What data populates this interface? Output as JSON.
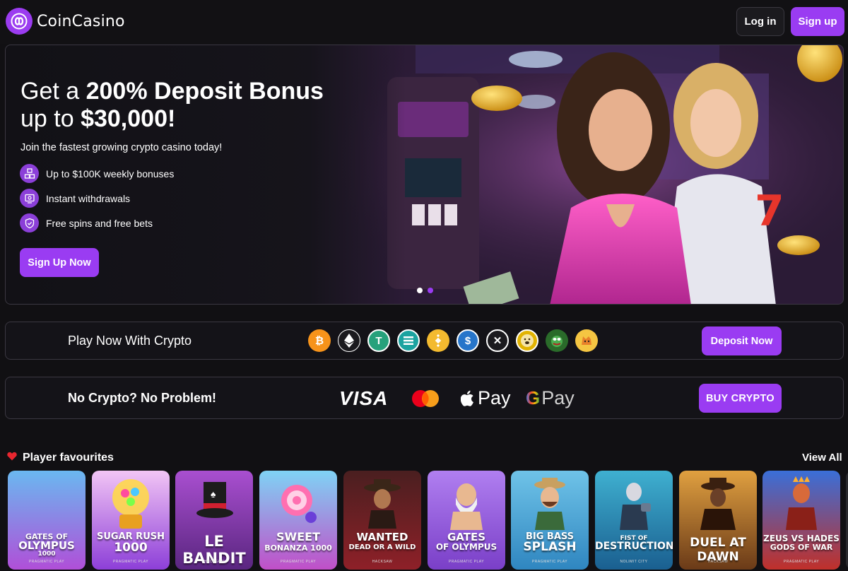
{
  "header": {
    "brand": "CoinCasino",
    "login_label": "Log in",
    "signup_label": "Sign up"
  },
  "hero": {
    "title_line1_prefix": "Get a ",
    "title_line1_bold": "200% Deposit Bonus",
    "title_line2_prefix": "up to ",
    "title_line2_bold": "$30,000!",
    "subtitle": "Join the fastest growing crypto casino today!",
    "features": [
      {
        "label": "Up to $100K weekly bonuses",
        "icon": "boxes-icon"
      },
      {
        "label": "Instant withdrawals",
        "icon": "monitor-icon"
      },
      {
        "label": "Free spins and free bets",
        "icon": "shield-icon"
      }
    ],
    "cta_label": "Sign Up Now",
    "slide_count": 2,
    "active_slide": 2
  },
  "crypto_bar": {
    "label": "Play Now With Crypto",
    "coins": [
      {
        "name": "bitcoin",
        "glyph": "₿",
        "color": "#f7931a"
      },
      {
        "name": "ethereum",
        "glyph": "◆",
        "color": "#ffffff"
      },
      {
        "name": "tether",
        "glyph": "T",
        "color": "#ffffff"
      },
      {
        "name": "solana",
        "glyph": "≡",
        "color": "#ffffff"
      },
      {
        "name": "bnb",
        "glyph": "◈",
        "color": "#f3ba2f"
      },
      {
        "name": "usd-coin",
        "glyph": "$",
        "color": "#2775ca"
      },
      {
        "name": "xrp",
        "glyph": "✕",
        "color": "#ffffff"
      },
      {
        "name": "dogecoin",
        "glyph": "Ð",
        "color": "#e1b303"
      },
      {
        "name": "pepe",
        "glyph": "●",
        "color": "#3a9b3a"
      },
      {
        "name": "shiba-inu",
        "glyph": "●",
        "color": "#f0a030"
      }
    ],
    "button_label": "Deposit Now"
  },
  "fiat_bar": {
    "label": "No Crypto? No Problem!",
    "visa": "VISA",
    "apple_pay": "Pay",
    "google_pay": "Pay",
    "button_label": "BUY CRYPTO"
  },
  "favourites": {
    "title": "Player favourites",
    "view_all": "View All",
    "games": [
      {
        "line1": "GATES OF",
        "line2": "OLYMPUS",
        "line3": "1000",
        "provider": "PRAGMATIC PLAY",
        "bg1": "#6ab8f0",
        "bg2": "#b04fd8"
      },
      {
        "line1": "SUGAR RUSH",
        "line2": "1000",
        "line3": "",
        "provider": "PRAGMATIC PLAY",
        "bg1": "#f2c5f5",
        "bg2": "#8d3fd8"
      },
      {
        "line1": "LE BANDIT",
        "line2": "",
        "line3": "",
        "provider": "HACKSAW",
        "bg1": "#a94fd0",
        "bg2": "#5a2680"
      },
      {
        "line1": "SWEET",
        "line2": "BONANZA 1000",
        "line3": "",
        "provider": "PRAGMATIC PLAY",
        "bg1": "#7fd3f5",
        "bg2": "#c04fc8"
      },
      {
        "line1": "WANTED",
        "line2": "DEAD OR A WILD",
        "line3": "",
        "provider": "HACKSAW",
        "bg1": "#4a1f20",
        "bg2": "#8e2028"
      },
      {
        "line1": "GATES",
        "line2": "OF OLYMPUS",
        "line3": "",
        "provider": "PRAGMATIC PLAY",
        "bg1": "#b07ff0",
        "bg2": "#7a3fc8"
      },
      {
        "line1": "BIG BASS",
        "line2": "SPLASH",
        "line3": "",
        "provider": "PRAGMATIC PLAY",
        "bg1": "#6fc3e8",
        "bg2": "#2f86c0"
      },
      {
        "line1": "FIST OF",
        "line2": "DESTRUCTION",
        "line3": "",
        "provider": "NOLIMIT CITY",
        "bg1": "#3fb0d0",
        "bg2": "#1a5f90"
      },
      {
        "line1": "DUEL AT DAWN",
        "line2": "",
        "line3": "",
        "provider": "HACKSAW",
        "bg1": "#e0a040",
        "bg2": "#6a3a18"
      },
      {
        "line1": "ZEUS VS HADES",
        "line2": "GODS OF WAR",
        "line3": "",
        "provider": "PRAGMATIC PLAY",
        "bg1": "#3a6fd8",
        "bg2": "#c0302a"
      }
    ]
  }
}
